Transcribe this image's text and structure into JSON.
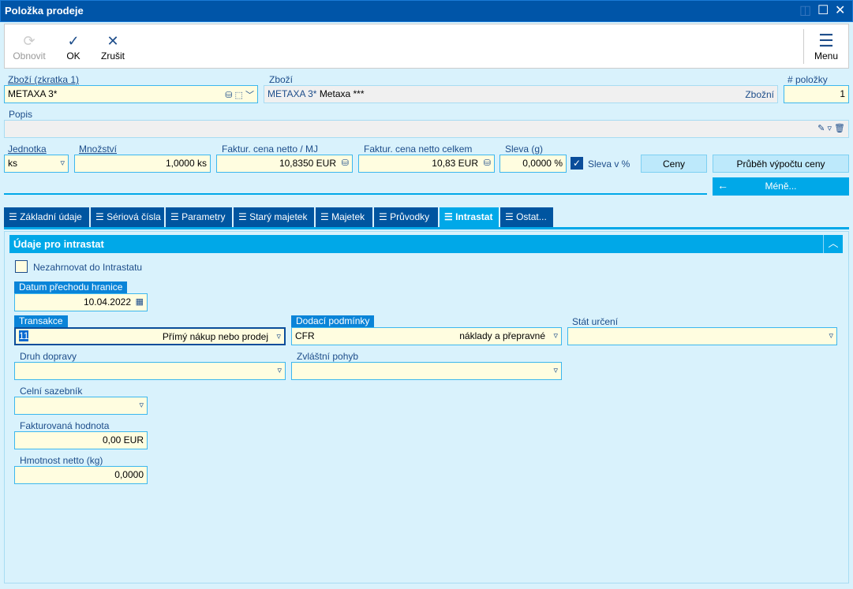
{
  "window": {
    "title": "Položka prodeje"
  },
  "toolbar": {
    "refresh": "Obnovit",
    "ok": "OK",
    "cancel": "Zrušit",
    "menu": "Menu"
  },
  "header": {
    "zbozi_zkratka_label": "Zboží (zkratka 1)",
    "zbozi_zkratka_value": "METAXA 3*",
    "zbozi_label": "Zboží",
    "zbozi_code": "METAXA 3*",
    "zbozi_name": "Metaxa ***",
    "zbozi_type": "Zbožní",
    "polozky_label": "# položky",
    "polozky_value": "1",
    "popis_label": "Popis",
    "popis_value": "",
    "jednotka_label": "Jednotka",
    "jednotka_value": "ks",
    "mnozstvi_label": "Množství",
    "mnozstvi_value": "1,0000 ks",
    "cena_mj_label": "Faktur. cena netto / MJ",
    "cena_mj_value": "10,8350 EUR",
    "cena_celkem_label": "Faktur. cena netto celkem",
    "cena_celkem_value": "10,83 EUR",
    "sleva_label": "Sleva (g)",
    "sleva_value": "0,0000 %",
    "sleva_pct_label": "Sleva v %",
    "sleva_pct_checked": true,
    "ceny_button": "Ceny",
    "prubeh_button": "Průběh výpočtu ceny",
    "mene_button": "Méně..."
  },
  "tabs": [
    "Základní údaje",
    "Sériová čísla",
    "Parametry",
    "Starý majetek",
    "Majetek",
    "Průvodky",
    "Intrastat",
    "Ostat..."
  ],
  "active_tab": "Intrastat",
  "intrastat": {
    "section_title": "Údaje pro intrastat",
    "nezahrnovat_label": "Nezahrnovat do Intrastatu",
    "nezahrnovat_checked": false,
    "datum_label": "Datum přechodu hranice",
    "datum_value": "10.04.2022",
    "transakce_label": "Transakce",
    "transakce_code": "11",
    "transakce_text": "Přímý nákup nebo prodej",
    "dodaci_label": "Dodací podmínky",
    "dodaci_code": "CFR",
    "dodaci_text": "náklady a přepravné",
    "stat_label": "Stát určení",
    "stat_value": "",
    "druh_label": "Druh dopravy",
    "druh_value": "",
    "pohyb_label": "Zvláštní pohyb",
    "pohyb_value": "",
    "sazebnik_label": "Celní sazebník",
    "sazebnik_value": "",
    "hodnota_label": "Fakturovaná hodnota",
    "hodnota_value": "0,00 EUR",
    "hmotnost_label": "Hmotnost netto (kg)",
    "hmotnost_value": "0,0000"
  }
}
